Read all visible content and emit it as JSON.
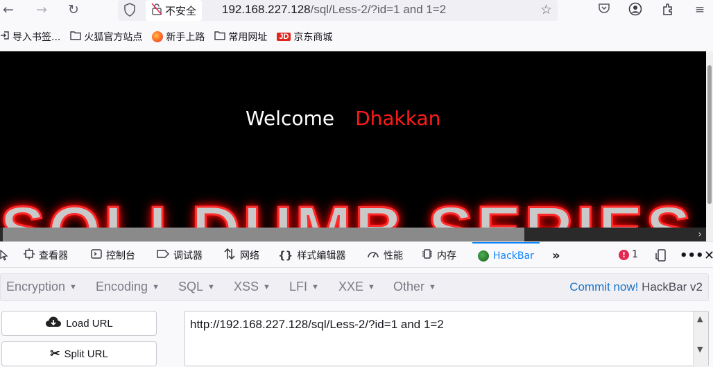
{
  "toolbar": {
    "back_icon": "←",
    "forward_icon": "→",
    "reload_icon": "↻",
    "shield_icon": "shield",
    "insecure_label": "不安全",
    "url_host": "192.168.227.128",
    "url_path": "/sql/Less-2/?id=1 and 1=2",
    "star_icon": "☆",
    "pocket_icon": "pocket",
    "account_icon": "account",
    "extensions_icon": "extensions",
    "menu_icon": "≡"
  },
  "bookmarks": [
    {
      "label": "导入书签...",
      "icon": "import-icon"
    },
    {
      "label": "火狐官方站点",
      "icon": "folder-icon"
    },
    {
      "label": "新手上路",
      "icon": "firefox-icon"
    },
    {
      "label": "常用网址",
      "icon": "folder-icon"
    },
    {
      "label": "京东商城",
      "icon": "jd-icon",
      "badge": "JD"
    }
  ],
  "page": {
    "welcome": "Welcome",
    "name": "Dhakkan",
    "banner": "SQLI DUMB SERIES"
  },
  "devtools": {
    "tabs": [
      {
        "label": "查看器",
        "icon": "inspector-icon"
      },
      {
        "label": "控制台",
        "icon": "console-icon"
      },
      {
        "label": "调试器",
        "icon": "debugger-icon"
      },
      {
        "label": "网络",
        "icon": "network-icon"
      },
      {
        "label": "样式编辑器",
        "icon": "style-editor-icon"
      },
      {
        "label": "性能",
        "icon": "performance-icon"
      },
      {
        "label": "内存",
        "icon": "memory-icon"
      },
      {
        "label": "HackBar",
        "icon": "hackbar-icon",
        "active": true
      }
    ],
    "error_count": "1",
    "more_icon": "»"
  },
  "hackbar": {
    "menu": [
      "Encryption",
      "Encoding",
      "SQL",
      "XSS",
      "LFI",
      "XXE",
      "Other"
    ],
    "commit_link": "Commit now!",
    "version": "HackBar v2",
    "load_url": "Load URL",
    "split_url": "Split URL",
    "url_value": "http://192.168.227.128/sql/Less-2/?id=1 and 1=2"
  },
  "colors": {
    "accent": "#0a84ff",
    "welcome_name": "#ff1a1a",
    "error": "#e22850",
    "commit_link": "#1a73c7"
  }
}
